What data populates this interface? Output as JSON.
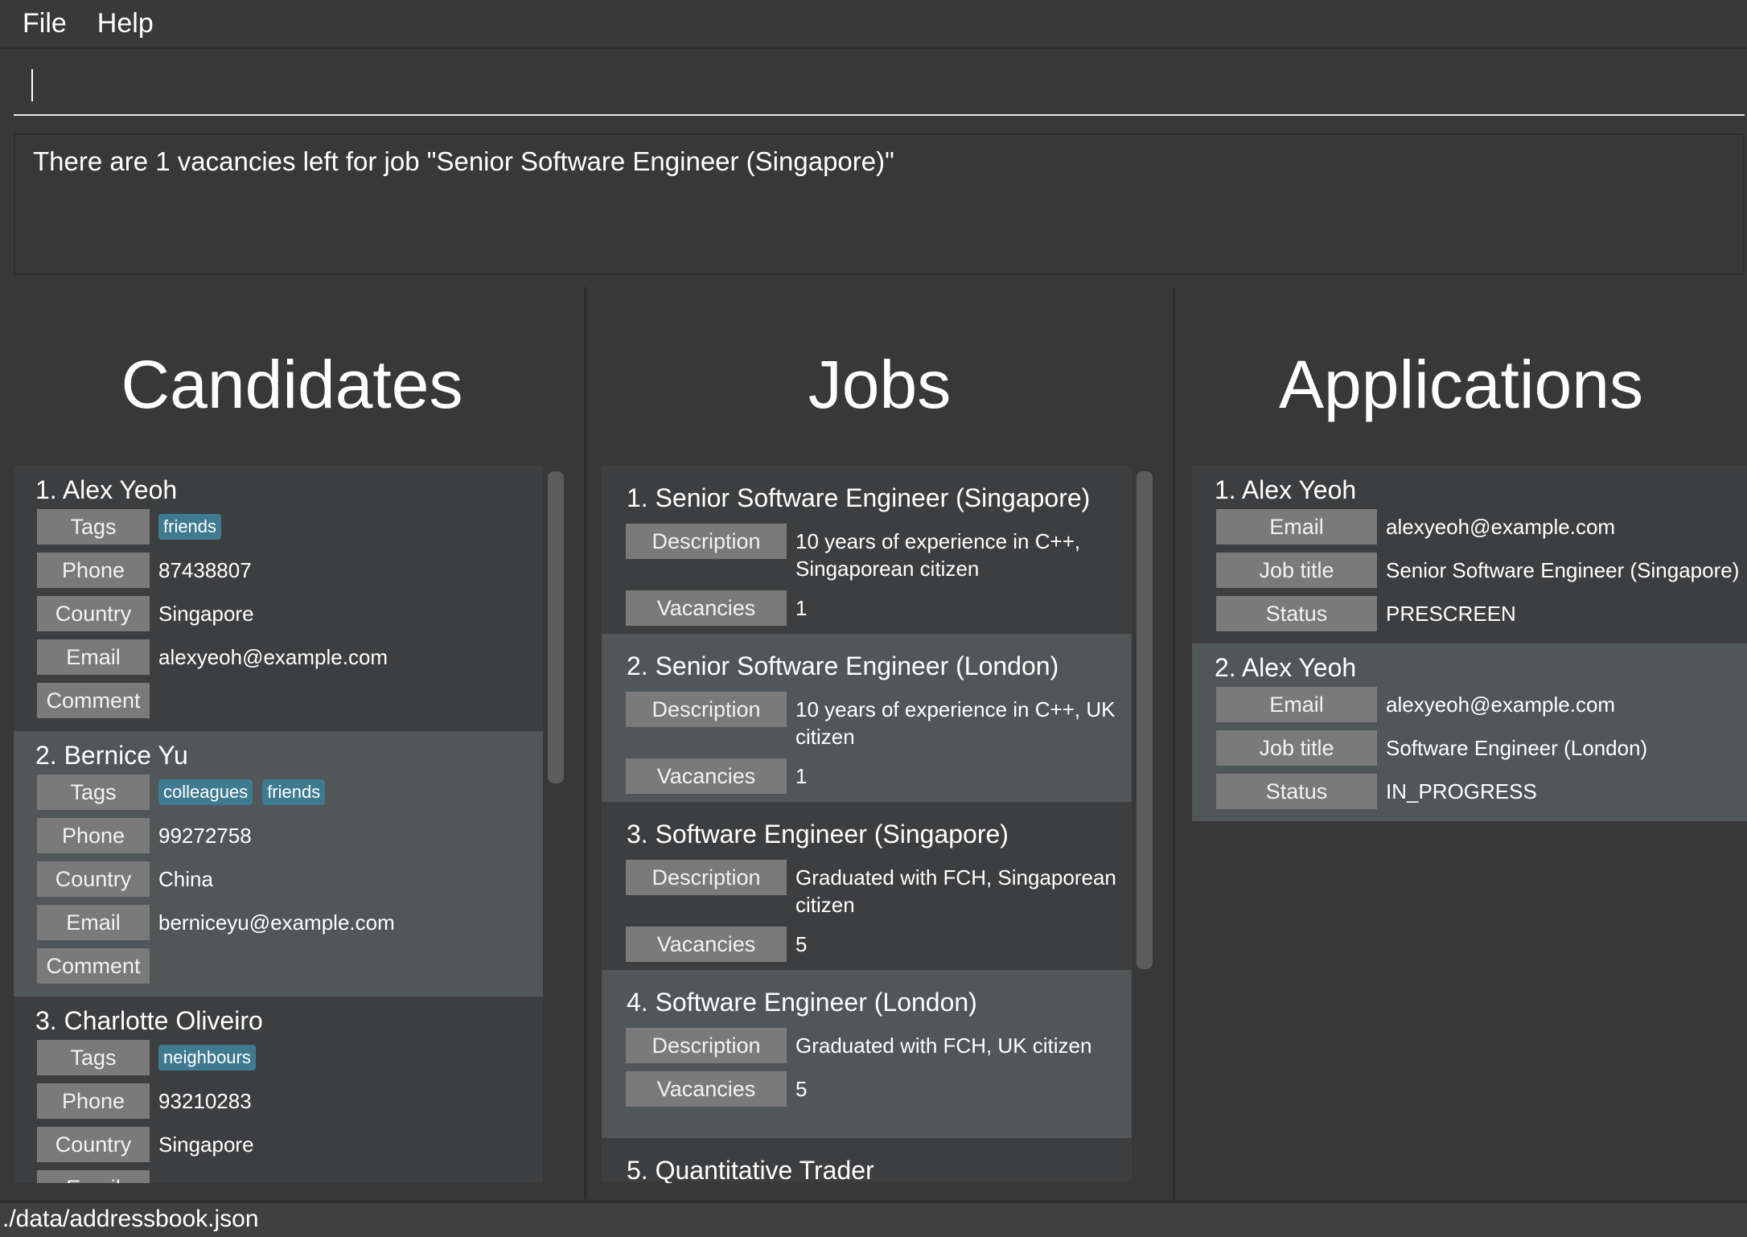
{
  "menu": {
    "file": "File",
    "help": "Help"
  },
  "command": {
    "value": ""
  },
  "result": {
    "text": "There are 1 vacancies left for job \"Senior Software Engineer (Singapore)\""
  },
  "candidates": {
    "title": "Candidates",
    "items": [
      {
        "name": "1.  Alex Yeoh",
        "tags": [
          "friends"
        ],
        "phone": "87438807",
        "country": "Singapore",
        "email": "alexyeoh@example.com",
        "comment": ""
      },
      {
        "name": "2.  Bernice Yu",
        "tags": [
          "colleagues",
          "friends"
        ],
        "phone": "99272758",
        "country": "China",
        "email": "berniceyu@example.com",
        "comment": ""
      },
      {
        "name": "3.  Charlotte Oliveiro",
        "tags": [
          "neighbours"
        ],
        "phone": "93210283",
        "country": "Singapore",
        "email": "",
        "comment": ""
      }
    ],
    "labels": {
      "tags": "Tags",
      "phone": "Phone",
      "country": "Country",
      "email": "Email",
      "comment": "Comment"
    }
  },
  "jobs": {
    "title": "Jobs",
    "items": [
      {
        "name": "1.  Senior Software Engineer (Singapore)",
        "description": "10 years of experience in C++, Singaporean citizen",
        "vacancies": "1"
      },
      {
        "name": "2.  Senior Software Engineer (London)",
        "description": "10 years of experience in C++, UK citizen",
        "vacancies": "1"
      },
      {
        "name": "3.  Software Engineer (Singapore)",
        "description": "Graduated with FCH, Singaporean citizen",
        "vacancies": "5"
      },
      {
        "name": "4.  Software Engineer (London)",
        "description": "Graduated with FCH, UK citizen",
        "vacancies": "5"
      },
      {
        "name": "5.  Quantitative Trader"
      }
    ],
    "labels": {
      "description": "Description",
      "vacancies": "Vacancies"
    }
  },
  "applications": {
    "title": "Applications",
    "items": [
      {
        "name": "1. Alex Yeoh",
        "email": "alexyeoh@example.com",
        "job_title": "Senior Software Engineer (Singapore)",
        "status": "PRESCREEN"
      },
      {
        "name": "2. Alex Yeoh",
        "email": "alexyeoh@example.com",
        "job_title": "Software Engineer (London)",
        "status": "IN_PROGRESS"
      }
    ],
    "labels": {
      "email": "Email",
      "job_title": "Job title",
      "status": "Status"
    }
  },
  "status_bar": {
    "path": "./data/addressbook.json"
  },
  "colors": {
    "tag": "#3e7b91",
    "label": "#7a7a7a",
    "card_alt": "#515658"
  }
}
